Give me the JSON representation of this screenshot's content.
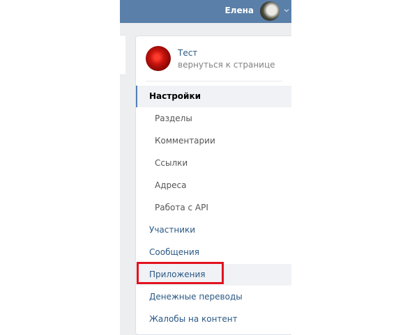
{
  "header": {
    "user_name": "Елена",
    "background_color": "#5a7fa8"
  },
  "community": {
    "name": "Тест",
    "back_link": "вернуться к странице"
  },
  "menu": {
    "settings": "Настройки",
    "sections": "Разделы",
    "comments": "Комментарии",
    "links": "Ссылки",
    "addresses": "Адреса",
    "api": "Работа с API",
    "members": "Участники",
    "messages": "Сообщения",
    "apps": "Приложения",
    "money_transfers": "Денежные переводы",
    "reports": "Жалобы на контент"
  },
  "colors": {
    "link": "#2a5885",
    "active_marker": "#5181b8",
    "highlight_annotation": "#e3121f"
  }
}
